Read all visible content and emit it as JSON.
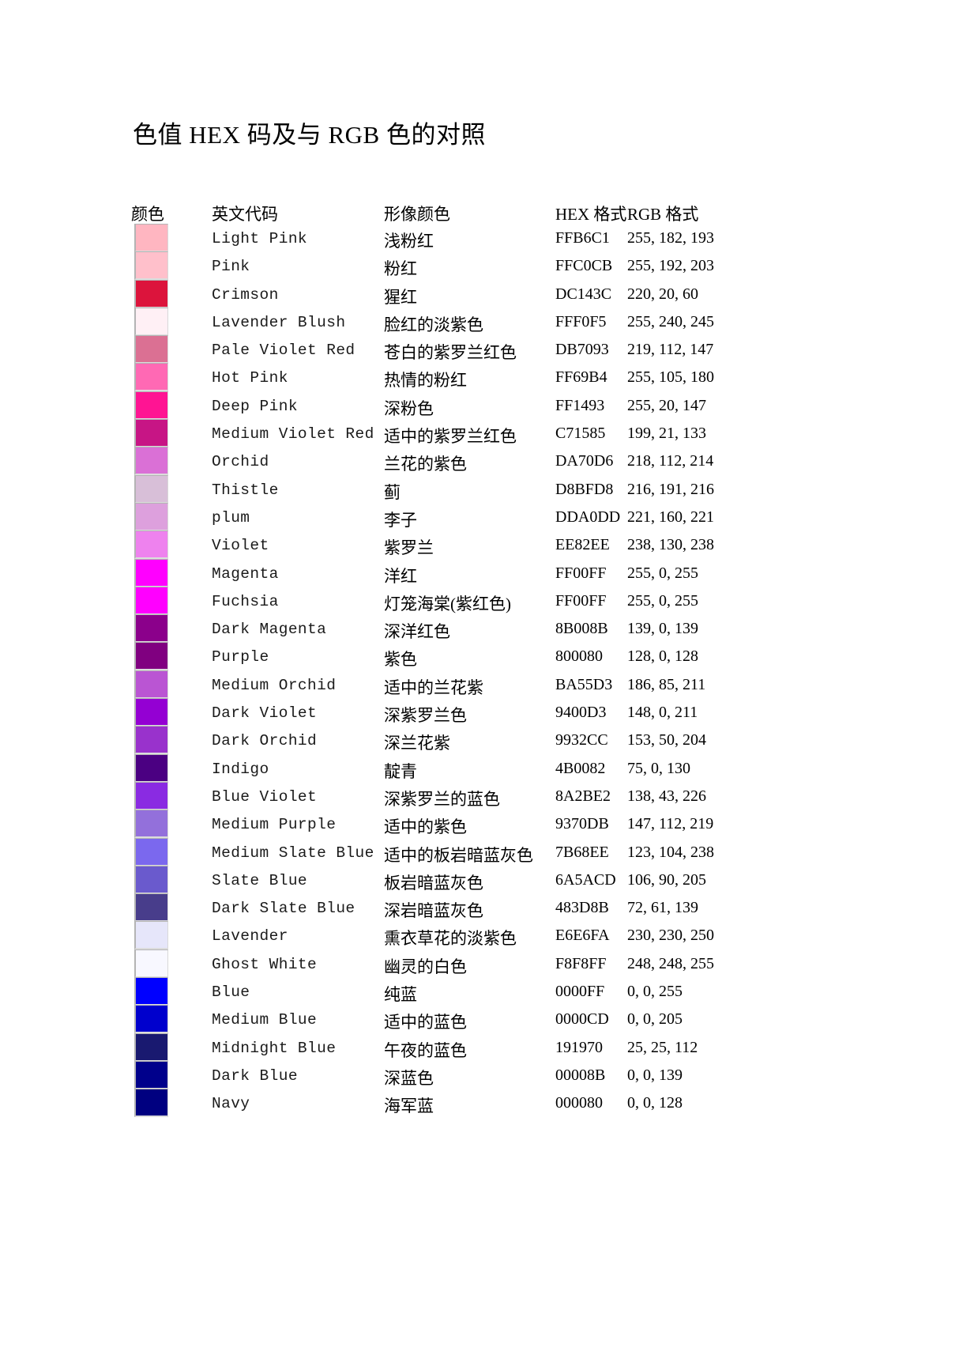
{
  "document": {
    "title": "色值 HEX 码及与 RGB 色的对照"
  },
  "table": {
    "headers": {
      "swatch": "颜色",
      "english": "英文代码",
      "chinese": "形像颜色",
      "hex": "HEX 格式",
      "rgb": "RGB 格式"
    },
    "rows": [
      {
        "english": "Light Pink",
        "chinese": "浅粉红",
        "hex": "FFB6C1",
        "rgb": "255, 182, 193",
        "swatch": "#FFB6C1"
      },
      {
        "english": "Pink",
        "chinese": "粉红",
        "hex": "FFC0CB",
        "rgb": "255, 192, 203",
        "swatch": "#FFC0CB"
      },
      {
        "english": "Crimson",
        "chinese": "猩红",
        "hex": "DC143C",
        "rgb": "220, 20, 60",
        "swatch": "#DC143C"
      },
      {
        "english": "Lavender Blush",
        "chinese": "脸红的淡紫色",
        "hex": "FFF0F5",
        "rgb": "255, 240, 245",
        "swatch": "#FFF0F5"
      },
      {
        "english": "Pale Violet Red",
        "chinese": "苍白的紫罗兰红色",
        "hex": "DB7093",
        "rgb": "219, 112, 147",
        "swatch": "#DB7093"
      },
      {
        "english": "Hot Pink",
        "chinese": "热情的粉红",
        "hex": "FF69B4",
        "rgb": "255, 105, 180",
        "swatch": "#FF69B4"
      },
      {
        "english": "Deep Pink",
        "chinese": "深粉色",
        "hex": "FF1493",
        "rgb": "255, 20, 147",
        "swatch": "#FF1493"
      },
      {
        "english": "Medium Violet Red",
        "chinese": "适中的紫罗兰红色",
        "hex": "C71585",
        "rgb": "199, 21, 133",
        "swatch": "#C71585"
      },
      {
        "english": "Orchid",
        "chinese": "兰花的紫色",
        "hex": "DA70D6",
        "rgb": "218, 112, 214",
        "swatch": "#DA70D6"
      },
      {
        "english": "Thistle",
        "chinese": "蓟",
        "hex": "D8BFD8",
        "rgb": "216, 191, 216",
        "swatch": "#D8BFD8"
      },
      {
        "english": "plum",
        "chinese": "李子",
        "hex": "DDA0DD",
        "rgb": "221, 160, 221",
        "swatch": "#DDA0DD"
      },
      {
        "english": "Violet",
        "chinese": "紫罗兰",
        "hex": "EE82EE",
        "rgb": "238, 130, 238",
        "swatch": "#EE82EE"
      },
      {
        "english": "Magenta",
        "chinese": "洋红",
        "hex": "FF00FF",
        "rgb": "255, 0, 255",
        "swatch": "#FF00FF"
      },
      {
        "english": "Fuchsia",
        "chinese": "灯笼海棠(紫红色)",
        "hex": "FF00FF",
        "rgb": "255, 0, 255",
        "swatch": "#FF00FF"
      },
      {
        "english": "Dark Magenta",
        "chinese": "深洋红色",
        "hex": "8B008B",
        "rgb": "139, 0, 139",
        "swatch": "#8B008B"
      },
      {
        "english": "Purple",
        "chinese": "紫色",
        "hex": "800080",
        "rgb": "128, 0, 128",
        "swatch": "#800080"
      },
      {
        "english": "Medium Orchid",
        "chinese": "适中的兰花紫",
        "hex": "BA55D3",
        "rgb": "186, 85, 211",
        "swatch": "#BA55D3"
      },
      {
        "english": "Dark Violet",
        "chinese": "深紫罗兰色",
        "hex": "9400D3",
        "rgb": "148, 0, 211",
        "swatch": "#9400D3"
      },
      {
        "english": "Dark Orchid",
        "chinese": "深兰花紫",
        "hex": "9932CC",
        "rgb": "153, 50, 204",
        "swatch": "#9932CC"
      },
      {
        "english": "Indigo",
        "chinese": "靛青",
        "hex": "4B0082",
        "rgb": "75, 0, 130",
        "swatch": "#4B0082"
      },
      {
        "english": "Blue Violet",
        "chinese": "深紫罗兰的蓝色",
        "hex": "8A2BE2",
        "rgb": "138, 43, 226",
        "swatch": "#8A2BE2"
      },
      {
        "english": "Medium Purple",
        "chinese": "适中的紫色",
        "hex": "9370DB",
        "rgb": "147, 112, 219",
        "swatch": "#9370DB"
      },
      {
        "english": "Medium Slate Blue",
        "chinese": "适中的板岩暗蓝灰色",
        "hex": "7B68EE",
        "rgb": "123, 104, 238",
        "swatch": "#7B68EE"
      },
      {
        "english": "Slate Blue",
        "chinese": "板岩暗蓝灰色",
        "hex": "6A5ACD",
        "rgb": "106, 90, 205",
        "swatch": "#6A5ACD"
      },
      {
        "english": "Dark Slate Blue",
        "chinese": "深岩暗蓝灰色",
        "hex": "483D8B",
        "rgb": "72, 61, 139",
        "swatch": "#483D8B"
      },
      {
        "english": "Lavender",
        "chinese": "熏衣草花的淡紫色",
        "hex": "E6E6FA",
        "rgb": "230, 230, 250",
        "swatch": "#E6E6FA"
      },
      {
        "english": "Ghost White",
        "chinese": "幽灵的白色",
        "hex": "F8F8FF",
        "rgb": "248, 248, 255",
        "swatch": "#F8F8FF"
      },
      {
        "english": "Blue",
        "chinese": "纯蓝",
        "hex": "0000FF",
        "rgb": "0, 0, 255",
        "swatch": "#0000FF"
      },
      {
        "english": "Medium Blue",
        "chinese": "适中的蓝色",
        "hex": "0000CD",
        "rgb": "0, 0, 205",
        "swatch": "#0000CD"
      },
      {
        "english": "Midnight Blue",
        "chinese": "午夜的蓝色",
        "hex": "191970",
        "rgb": "25, 25, 112",
        "swatch": "#191970"
      },
      {
        "english": "Dark Blue",
        "chinese": "深蓝色",
        "hex": "00008B",
        "rgb": "0, 0, 139",
        "swatch": "#00008B"
      },
      {
        "english": "Navy",
        "chinese": "海军蓝",
        "hex": "000080",
        "rgb": "0, 0, 128",
        "swatch": "#000080"
      }
    ]
  }
}
